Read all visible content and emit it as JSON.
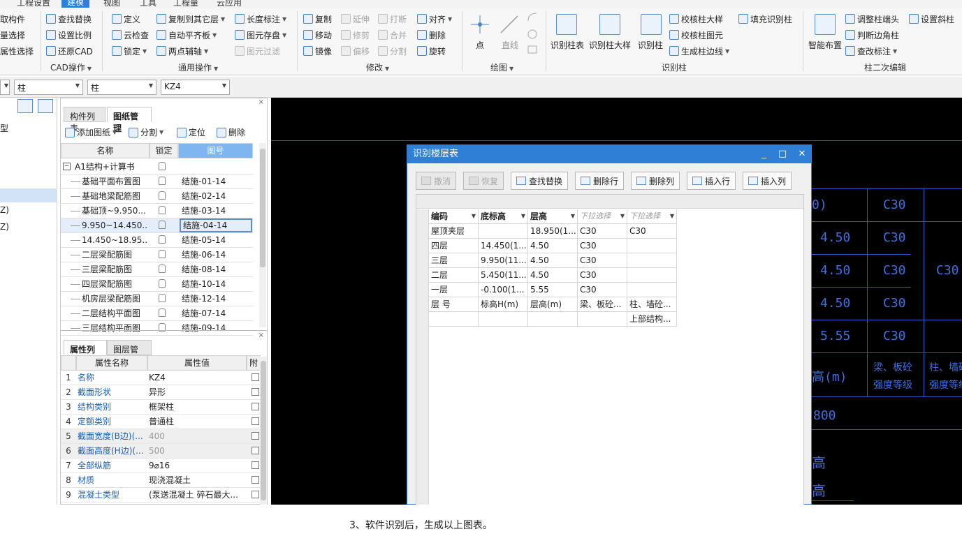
{
  "menubar": {
    "tabs": [
      "工程设置",
      "建模",
      "视图",
      "工具",
      "工程量",
      "云应用"
    ],
    "active": "建模"
  },
  "ribbon": {
    "left_partial": [
      "取构件",
      "量选择",
      "属性选择"
    ],
    "cad_ops": {
      "items": [
        "查找替换",
        "设置比例",
        "还原CAD"
      ],
      "label": "CAD操作"
    },
    "general_ops": {
      "col1": [
        "定义",
        "云检查",
        "锁定"
      ],
      "col2": [
        "复制到其它层",
        "自动平齐板",
        "两点辅轴"
      ],
      "col3": [
        "长度标注",
        "图元存盘",
        "图元过滤"
      ],
      "label": "通用操作"
    },
    "modify": {
      "col1": [
        "复制",
        "移动",
        "镜像"
      ],
      "col2": [
        "延伸",
        "修剪",
        "偏移"
      ],
      "col3": [
        "打断",
        "合并",
        "分割"
      ],
      "col4": [
        "对齐",
        "删除",
        "旋转"
      ],
      "label": "修改"
    },
    "draw": {
      "items": [
        "点",
        "直线"
      ],
      "label": "绘图"
    },
    "identify_column": {
      "big": [
        "识别柱表",
        "识别柱大样",
        "识别柱"
      ],
      "col": [
        "校核柱大样",
        "校核柱图元",
        "生成柱边线"
      ],
      "extra": "填充识别柱",
      "label": "识别柱"
    },
    "column_edit": {
      "big": "智能布置",
      "col": [
        "调整柱端头",
        "判断边角柱",
        "查改标注"
      ],
      "extra": "设置斜柱",
      "label": "柱二次编辑"
    }
  },
  "selector": {
    "combo1": "柱",
    "combo2": "柱",
    "combo3": "KZ4"
  },
  "leftnav": {
    "items": [
      "型",
      "Z)",
      "Z)"
    ]
  },
  "drawings": {
    "tabs": [
      "构件列表",
      "图纸管理"
    ],
    "toolbar": [
      "添加图纸",
      "分割",
      "定位",
      "删除"
    ],
    "headers": [
      "名称",
      "锁定",
      "图号"
    ],
    "root": "A1结构+计算书",
    "rows": [
      {
        "name": "基础平面布置图",
        "num": "结施-01-14"
      },
      {
        "name": "基础地梁配筋图",
        "num": "结施-02-14"
      },
      {
        "name": "基础顶~9.950...",
        "num": "结施-03-14"
      },
      {
        "name": "9.950~14.450...",
        "num": "结施-04-14"
      },
      {
        "name": "14.450~18.95...",
        "num": "结施-05-14"
      },
      {
        "name": "二层梁配筋图",
        "num": "结施-06-14"
      },
      {
        "name": "三层梁配筋图",
        "num": "结施-08-14"
      },
      {
        "name": "四层梁配筋图",
        "num": "结施-10-14"
      },
      {
        "name": "机房层梁配筋图",
        "num": "结施-12-14"
      },
      {
        "name": "二层结构平面图",
        "num": "结施-07-14"
      },
      {
        "name": "三层结构平面图",
        "num": "结施-09-14"
      }
    ]
  },
  "properties": {
    "tabs": [
      "属性列表",
      "图层管理"
    ],
    "headers": [
      "属性名称",
      "属性值",
      "附"
    ],
    "rows": [
      {
        "n": "1",
        "k": "名称",
        "v": "KZ4"
      },
      {
        "n": "2",
        "k": "截面形状",
        "v": "异形"
      },
      {
        "n": "3",
        "k": "结构类别",
        "v": "框架柱"
      },
      {
        "n": "4",
        "k": "定额类别",
        "v": "普通柱"
      },
      {
        "n": "5",
        "k": "截面宽度(B边)(...",
        "v": "400"
      },
      {
        "n": "6",
        "k": "截面高度(H边)(...",
        "v": "500"
      },
      {
        "n": "7",
        "k": "全部纵筋",
        "v": "9⌀16"
      },
      {
        "n": "8",
        "k": "材质",
        "v": "现浇混凝土"
      },
      {
        "n": "9",
        "k": "混凝土类型",
        "v": "(泵送混凝土 碎石最大..."
      }
    ]
  },
  "canvas": {
    "texts": [
      "0)",
      "C30",
      "4.50",
      "C30",
      "4.50",
      "C30",
      "C30",
      "4.50",
      "C30",
      "5.55",
      "C30",
      "高(m)",
      "梁、板砼",
      "强度等级",
      "柱、墙砼",
      "强度等级",
      "800",
      "高",
      "高"
    ]
  },
  "dialog": {
    "title": "识别楼层表",
    "buttons": [
      "撤消",
      "恢复",
      "查找替换",
      "删除行",
      "删除列",
      "插入行",
      "插入列"
    ],
    "headers": [
      "编码",
      "底标高",
      "层高",
      "下拉选择",
      "下拉选择"
    ],
    "rows": [
      [
        "屋顶夹层",
        "",
        "18.950(1...",
        "C30",
        "C30"
      ],
      [
        "四层",
        "14.450(1...",
        "4.50",
        "C30",
        ""
      ],
      [
        "三层",
        "9.950(11...",
        "4.50",
        "C30",
        ""
      ],
      [
        "二层",
        "5.450(11...",
        "4.50",
        "C30",
        ""
      ],
      [
        "一层",
        "-0.100(1...",
        "5.55",
        "C30",
        ""
      ],
      [
        "层 号",
        "标高H(m)",
        "层高(m)",
        "梁、板砼...",
        "柱、墙砼..."
      ],
      [
        "",
        "",
        "",
        "",
        "上部结构..."
      ]
    ]
  },
  "caption": "3、软件识别后，生成以上图表。"
}
